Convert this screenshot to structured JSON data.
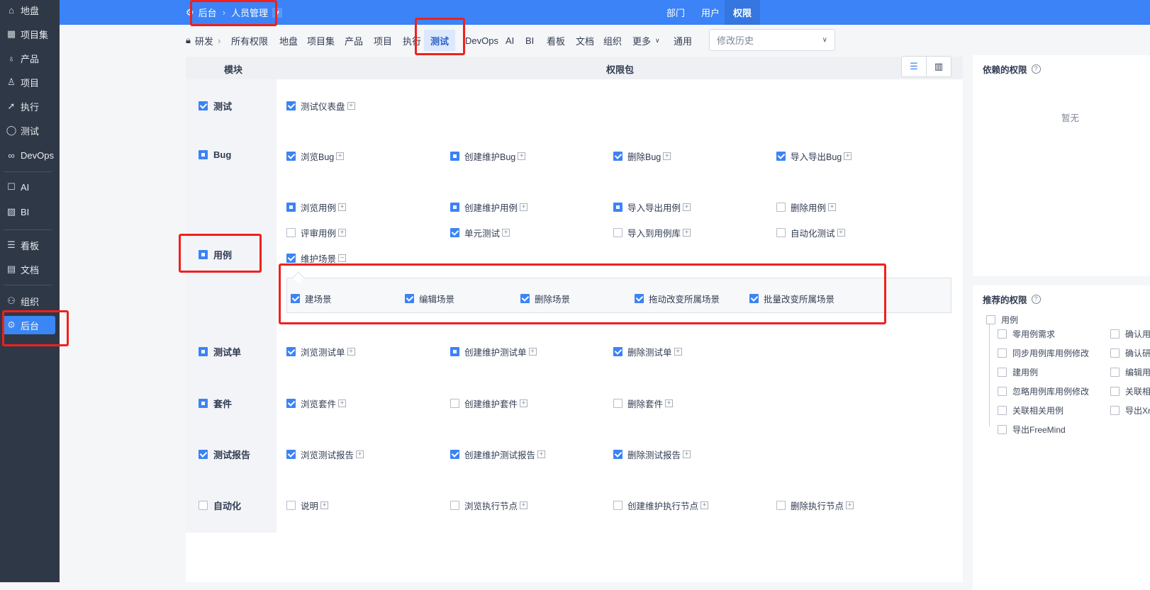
{
  "sidebar": {
    "items": [
      {
        "label": "地盘",
        "icon": "home-icon",
        "glyph": "⌂"
      },
      {
        "label": "项目集",
        "icon": "grid-icon",
        "glyph": "▦"
      },
      {
        "label": "产品",
        "icon": "lightbulb-icon",
        "glyph": "♁"
      },
      {
        "label": "项目",
        "icon": "rocket-icon",
        "glyph": "♙"
      },
      {
        "label": "执行",
        "icon": "send-icon",
        "glyph": "➚"
      },
      {
        "label": "测试",
        "icon": "search-icon",
        "glyph": "◯"
      },
      {
        "label": "DevOps",
        "icon": "infinity-icon",
        "glyph": "∞"
      },
      {
        "label": "AI",
        "icon": "robot-icon",
        "glyph": "☐"
      },
      {
        "label": "BI",
        "icon": "chart-board-icon",
        "glyph": "▨"
      },
      {
        "label": "看板",
        "icon": "kanban-icon",
        "glyph": "☰"
      },
      {
        "label": "文档",
        "icon": "document-icon",
        "glyph": "▤"
      },
      {
        "label": "组织",
        "icon": "users-icon",
        "glyph": "⚇"
      },
      {
        "label": "后台",
        "icon": "gear-icon",
        "glyph": "⚙"
      }
    ]
  },
  "topbar": {
    "breadcrumb": [
      "后台",
      "人员管理"
    ],
    "tabs": [
      "部门",
      "用户",
      "权限"
    ],
    "active_tab": "权限"
  },
  "toolbar": {
    "root": "研发",
    "items": [
      "所有权限",
      "地盘",
      "项目集",
      "产品",
      "项目",
      "执行",
      "测试",
      "DevOps",
      "AI",
      "BI",
      "看板",
      "文档",
      "组织",
      "更多",
      "通用"
    ],
    "active": "测试",
    "history_placeholder": "修改历史"
  },
  "table": {
    "col_module": "模块",
    "col_package": "权限包",
    "modules": [
      {
        "name": "测试",
        "state": "checked",
        "rows": [
          [
            {
              "label": "测试仪表盘",
              "state": "checked"
            }
          ]
        ]
      },
      {
        "name": "Bug",
        "state": "partial",
        "rows": [
          [
            {
              "label": "浏览Bug",
              "state": "checked"
            },
            {
              "label": "创建维护Bug",
              "state": "partial"
            },
            {
              "label": "删除Bug",
              "state": "checked"
            },
            {
              "label": "导入导出Bug",
              "state": "checked"
            }
          ]
        ]
      },
      {
        "name": "用例",
        "state": "partial",
        "rows": [
          [
            {
              "label": "浏览用例",
              "state": "partial"
            },
            {
              "label": "创建维护用例",
              "state": "partial"
            },
            {
              "label": "导入导出用例",
              "state": "partial"
            },
            {
              "label": "删除用例",
              "state": "unchecked"
            }
          ],
          [
            {
              "label": "评审用例",
              "state": "unchecked"
            },
            {
              "label": "单元测试",
              "state": "checked"
            },
            {
              "label": "导入到用例库",
              "state": "unchecked"
            },
            {
              "label": "自动化测试",
              "state": "unchecked"
            }
          ],
          [
            {
              "label": "维护场景",
              "state": "checked",
              "expanded": true
            }
          ]
        ],
        "expanded_items": [
          {
            "label": "建场景",
            "state": "checked"
          },
          {
            "label": "编辑场景",
            "state": "checked"
          },
          {
            "label": "删除场景",
            "state": "checked"
          },
          {
            "label": "拖动改变所属场景",
            "state": "checked"
          },
          {
            "label": "批量改变所属场景",
            "state": "checked"
          }
        ]
      },
      {
        "name": "测试单",
        "state": "partial",
        "rows": [
          [
            {
              "label": "浏览测试单",
              "state": "checked"
            },
            {
              "label": "创建维护测试单",
              "state": "partial"
            },
            {
              "label": "删除测试单",
              "state": "checked"
            }
          ]
        ]
      },
      {
        "name": "套件",
        "state": "partial",
        "rows": [
          [
            {
              "label": "浏览套件",
              "state": "checked"
            },
            {
              "label": "创建维护套件",
              "state": "unchecked"
            },
            {
              "label": "删除套件",
              "state": "unchecked"
            }
          ]
        ]
      },
      {
        "name": "测试报告",
        "state": "checked",
        "rows": [
          [
            {
              "label": "浏览测试报告",
              "state": "checked"
            },
            {
              "label": "创建维护测试报告",
              "state": "checked"
            },
            {
              "label": "删除测试报告",
              "state": "checked"
            }
          ]
        ]
      },
      {
        "name": "自动化",
        "state": "unchecked",
        "rows": [
          [
            {
              "label": "说明",
              "state": "unchecked"
            },
            {
              "label": "浏览执行节点",
              "state": "unchecked"
            },
            {
              "label": "创建维护执行节点",
              "state": "unchecked"
            },
            {
              "label": "删除执行节点",
              "state": "unchecked"
            }
          ]
        ]
      }
    ]
  },
  "depends": {
    "title": "依赖的权限",
    "empty": "暂无"
  },
  "recommend": {
    "title": "推荐的权限",
    "group": "用例",
    "col1": [
      "零用例需求",
      "同步用例库用例修改",
      "建用例",
      "忽略用例库用例修改",
      "关联相关用例",
      "导出FreeMind"
    ],
    "col2": [
      "确认用例",
      "确认研发",
      "编辑用例",
      "关联相关",
      "导出Xm"
    ]
  },
  "colors": {
    "accent": "#3b83f6",
    "sidebar": "#2f3847",
    "annotation": "#f0201c"
  }
}
